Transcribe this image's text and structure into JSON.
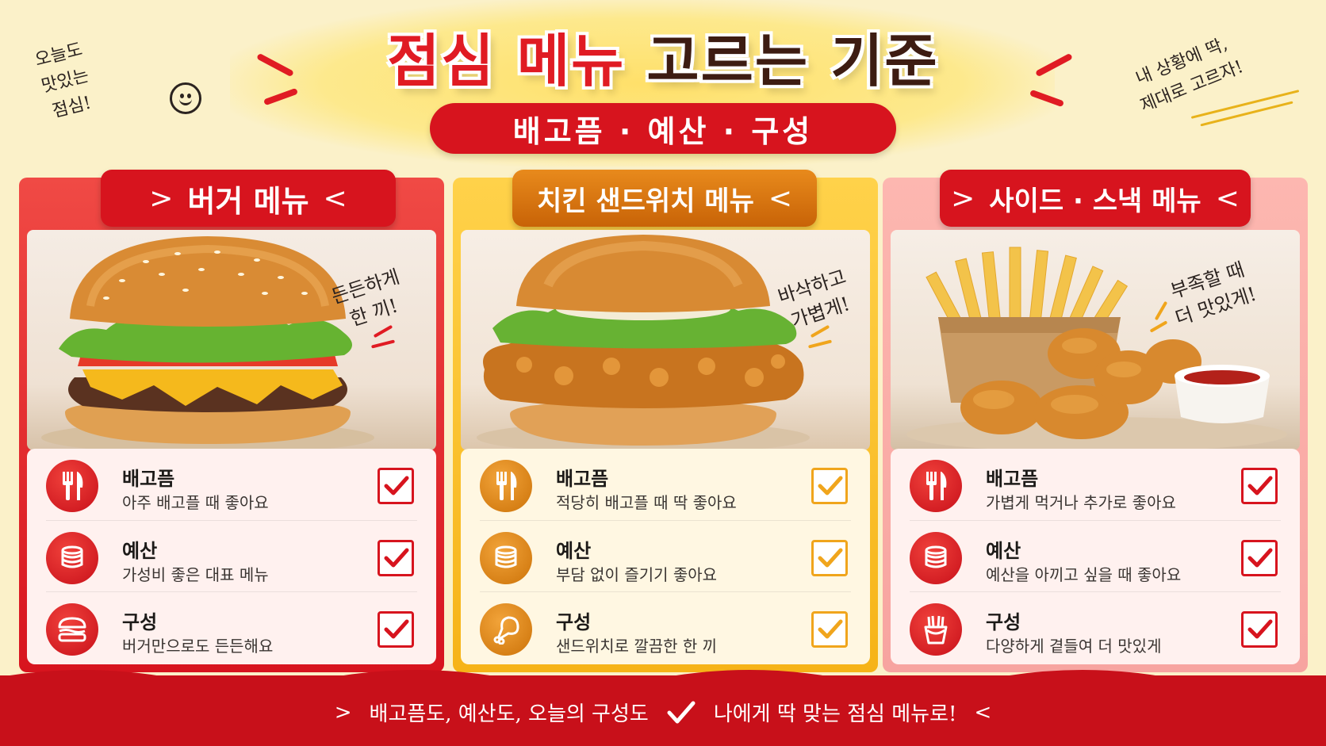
{
  "header": {
    "title_red": "점심 메뉴",
    "title_dark": "고르는 기준",
    "subtitle": "배고픔 · 예산 · 구성",
    "note_left": [
      "오늘도",
      "맛있는",
      "점심!"
    ],
    "note_right": [
      "내 상황에 딱,",
      "제대로 고르자!"
    ]
  },
  "cards": [
    {
      "title": "버거 메뉴",
      "photo_note": [
        "든든하게",
        "한 끼!"
      ],
      "rows": [
        {
          "title": "배고픔",
          "desc": "아주 배고플 때 좋아요",
          "icon": "fork-knife-icon"
        },
        {
          "title": "예산",
          "desc": "가성비 좋은 대표 메뉴",
          "icon": "coin-stack-icon"
        },
        {
          "title": "구성",
          "desc": "버거만으로도 든든해요",
          "icon": "burger-icon"
        }
      ]
    },
    {
      "title": "치킨 샌드위치 메뉴",
      "photo_note": [
        "바삭하고",
        "가볍게!"
      ],
      "rows": [
        {
          "title": "배고픔",
          "desc": "적당히 배고플 때 딱 좋아요",
          "icon": "fork-knife-icon"
        },
        {
          "title": "예산",
          "desc": "부담 없이 즐기기 좋아요",
          "icon": "coin-stack-icon"
        },
        {
          "title": "구성",
          "desc": "샌드위치로 깔끔한 한 끼",
          "icon": "chicken-leg-icon"
        }
      ]
    },
    {
      "title": "사이드 · 스낵 메뉴",
      "photo_note": [
        "부족할 때",
        "더 맛있게!"
      ],
      "rows": [
        {
          "title": "배고픔",
          "desc": "가볍게 먹거나 추가로 좋아요",
          "icon": "fork-knife-icon"
        },
        {
          "title": "예산",
          "desc": "예산을 아끼고 싶을 때 좋아요",
          "icon": "coin-stack-icon"
        },
        {
          "title": "구성",
          "desc": "다양하게 곁들여 더 맛있게",
          "icon": "fries-icon"
        }
      ]
    }
  ],
  "footer": {
    "left": "배고픔도, 예산도, 오늘의 구성도",
    "right": "나에게 딱 맞는 점심 메뉴로!"
  },
  "colors": {
    "red": "#d7141e",
    "orange": "#e88a1c",
    "pink": "#f7a4a0",
    "cream": "#fbf1c9",
    "brown": "#3d1c12"
  }
}
